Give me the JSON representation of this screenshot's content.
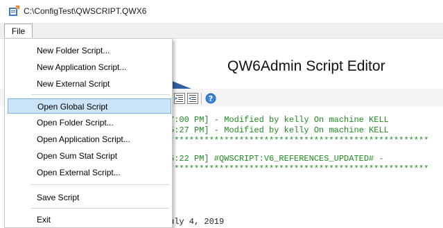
{
  "window": {
    "title": "C:\\ConfigTest\\QWSCRIPT.QWX6",
    "app_icon": "qw6-app-icon"
  },
  "menubar": {
    "file_label": "File"
  },
  "editor": {
    "title": "QW6Admin Script Editor",
    "toolbar_icons": [
      "indent-icon",
      "outdent-icon",
      "help-icon"
    ],
    "code_lines": [
      "7:00 PM] - Modified by kelly On machine KELL",
      "5:27 PM] - Modified by kelly On machine KELL",
      "****************************************************",
      "5:22 PM] #QWSCRIPT:V6_REFERENCES_UPDATED# -",
      "****************************************************",
      "uly 4, 2019"
    ]
  },
  "file_menu": {
    "items": [
      {
        "label": "New Folder Script..."
      },
      {
        "label": "New Application Script..."
      },
      {
        "label": "New External Script"
      },
      {
        "label": "Open Global Script"
      },
      {
        "label": "Open Folder Script..."
      },
      {
        "label": "Open Application Script..."
      },
      {
        "label": "Open Sum Stat Script"
      },
      {
        "label": "Open External Script..."
      },
      {
        "label": "Save Script"
      },
      {
        "label": "Exit"
      }
    ],
    "highlighted_item": "Open Global Script"
  },
  "colors": {
    "code_green": "#1f8b1f",
    "menu_highlight": "#cce4f7",
    "menu_highlight_border": "#7ab2de",
    "menubar_bg": "#f0f0f0"
  }
}
